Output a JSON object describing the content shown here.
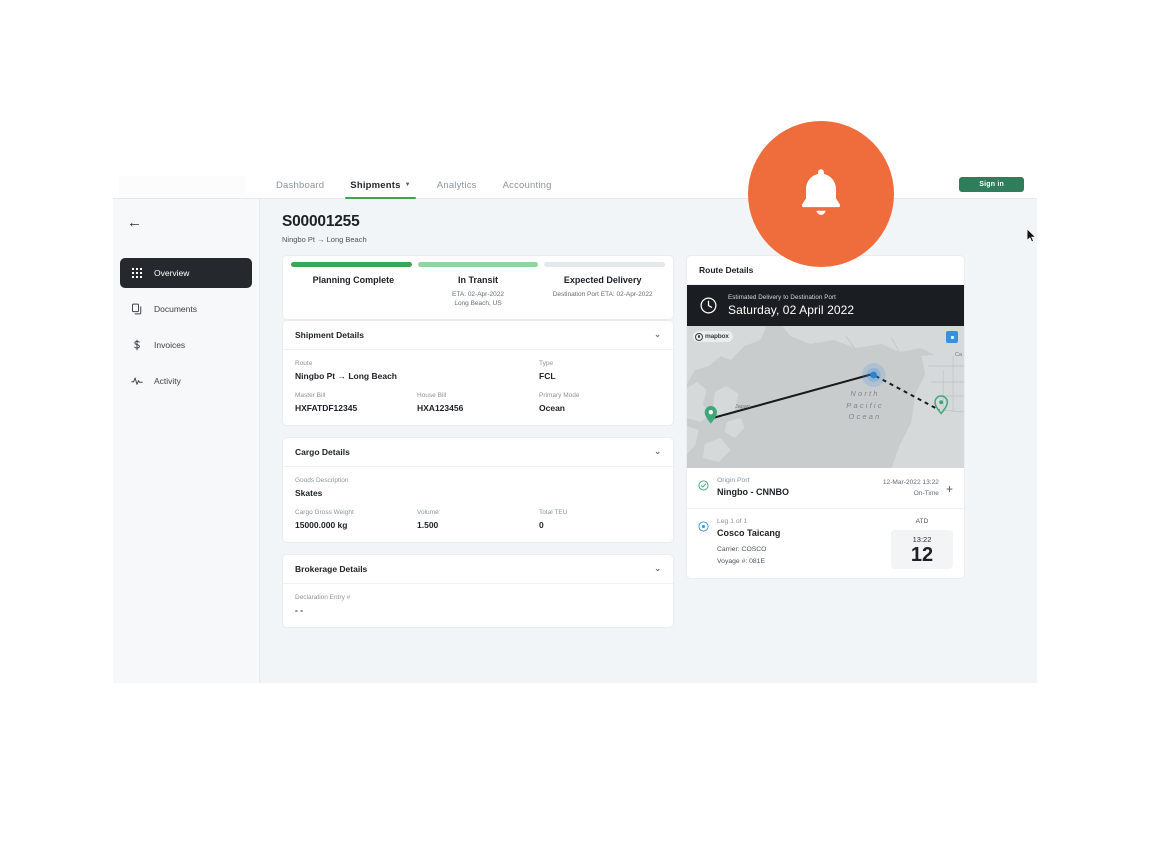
{
  "topnav": {
    "tabs": [
      {
        "label": "Dashboard",
        "active": false,
        "caret": false
      },
      {
        "label": "Shipments",
        "active": true,
        "caret": true
      },
      {
        "label": "Analytics",
        "active": false,
        "caret": false
      },
      {
        "label": "Accounting",
        "active": false,
        "caret": false
      }
    ],
    "signin_label": "Sign in"
  },
  "sidebar": {
    "back_icon": "arrow-left-icon",
    "items": [
      {
        "label": "Overview",
        "icon": "grid-icon",
        "active": true
      },
      {
        "label": "Documents",
        "icon": "documents-icon",
        "active": false
      },
      {
        "label": "Invoices",
        "icon": "dollar-icon",
        "active": false
      },
      {
        "label": "Activity",
        "icon": "activity-icon",
        "active": false
      }
    ]
  },
  "page": {
    "title": "S00001255",
    "subtitle": "Ningbo Pt → Long Beach"
  },
  "progress": {
    "stages": [
      {
        "name": "Planning Complete",
        "meta1": "",
        "meta2": "",
        "bar_color": "#3aa752"
      },
      {
        "name": "In Transit",
        "meta1": "ETA: 02-Apr-2022",
        "meta2": "Long Beach, US",
        "bar_color": "#8fd6a2"
      },
      {
        "name": "Expected Delivery",
        "meta1": "Destination Port ETA: 02-Apr-2022",
        "meta2": "",
        "bar_color": "#e4e8ea"
      }
    ]
  },
  "shipment_details": {
    "title": "Shipment Details",
    "route_label": "Route",
    "route_value": "Ningbo Pt → Long Beach",
    "type_label": "Type",
    "type_value": "FCL",
    "master_bill_label": "Master Bill",
    "master_bill_value": "HXFATDF12345",
    "house_bill_label": "House Bill",
    "house_bill_value": "HXA123456",
    "primary_mode_label": "Primary Mode",
    "primary_mode_value": "Ocean"
  },
  "cargo_details": {
    "title": "Cargo Details",
    "goods_label": "Goods Description",
    "goods_value": "Skates",
    "weight_label": "Cargo Gross Weight",
    "weight_value": "15000.000 kg",
    "volume_label": "Volume",
    "volume_value": "1.500",
    "teu_label": "Total TEU",
    "teu_value": "0"
  },
  "brokerage_details": {
    "title": "Brokerage Details",
    "declaration_label": "Declaration Entry #",
    "declaration_value": "- -"
  },
  "route_details": {
    "title": "Route Details",
    "eta_caption": "Estimated Delivery to Destination Port",
    "eta_date": "Saturday, 02 April 2022",
    "map": {
      "attribution": "mapbox",
      "ocean_label": "North Pacific Ocean",
      "country_label_1": "Japan",
      "country_label_2": "Ca"
    },
    "origin": {
      "label": "Origin Port",
      "value": "Ningbo - CNNBO",
      "datetime": "12-Mar-2022 13:22",
      "status": "On-Time",
      "expand": "+"
    },
    "leg": {
      "label": "Leg 1 of 1",
      "value": "Cosco Taicang",
      "carrier": "Carrier: COSCO",
      "voyage": "Voyage #: 081E",
      "atd_label": "ATD",
      "atd_time": "13:22",
      "atd_day": "12"
    }
  },
  "overlay": {
    "bell_icon": "bell-icon",
    "accent_color": "#ef6c3d"
  }
}
